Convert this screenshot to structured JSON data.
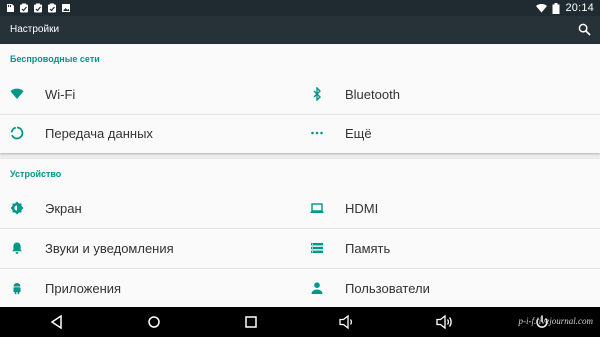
{
  "status_bar": {
    "notification_icons": [
      "sd-card-icon",
      "clipboard-check-icon",
      "clipboard-check-icon",
      "clipboard-check-icon",
      "image-icon"
    ],
    "time": "20:14"
  },
  "app_bar": {
    "title": "Настройки",
    "search_icon": "search-icon"
  },
  "sections": {
    "wireless": {
      "header": "Беспроводные сети",
      "items": [
        {
          "label": "Wi-Fi",
          "icon": "wifi-icon"
        },
        {
          "label": "Bluetooth",
          "icon": "bluetooth-icon"
        },
        {
          "label": "Передача данных",
          "icon": "data-usage-icon"
        },
        {
          "label": "Ещё",
          "icon": "more-icon"
        }
      ]
    },
    "device": {
      "header": "Устройство",
      "items": [
        {
          "label": "Экран",
          "icon": "brightness-icon"
        },
        {
          "label": "HDMI",
          "icon": "hdmi-icon"
        },
        {
          "label": "Звуки и уведомления",
          "icon": "bell-icon"
        },
        {
          "label": "Память",
          "icon": "storage-icon"
        },
        {
          "label": "Приложения",
          "icon": "android-icon"
        },
        {
          "label": "Пользователи",
          "icon": "person-icon"
        }
      ]
    }
  },
  "nav_bar": {
    "buttons": [
      "back-icon",
      "home-icon",
      "recents-icon",
      "volume-down-icon",
      "volume-up-icon",
      "power-icon"
    ],
    "watermark": "p-i-f.livejournal.com"
  },
  "colors": {
    "accent": "#009688",
    "app_bar": "#263238",
    "status_bar": "#1f2b30"
  }
}
